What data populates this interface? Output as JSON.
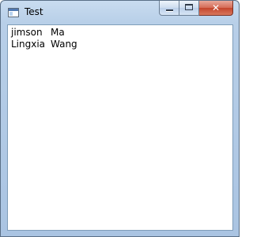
{
  "window": {
    "title": "Test",
    "icon": "window-app-icon",
    "buttons": {
      "minimize_icon": "minimize-icon",
      "maximize_icon": "maximize-icon",
      "close_icon": "close-icon",
      "close_glyph": "✕"
    }
  },
  "list": {
    "items": [
      {
        "first": "jimson",
        "last": "Ma"
      },
      {
        "first": "Lingxia",
        "last": "Wang"
      }
    ]
  },
  "colors": {
    "close_button": "#c4452c",
    "frame": "#b8cfe8",
    "client_border": "#7f9db9"
  }
}
